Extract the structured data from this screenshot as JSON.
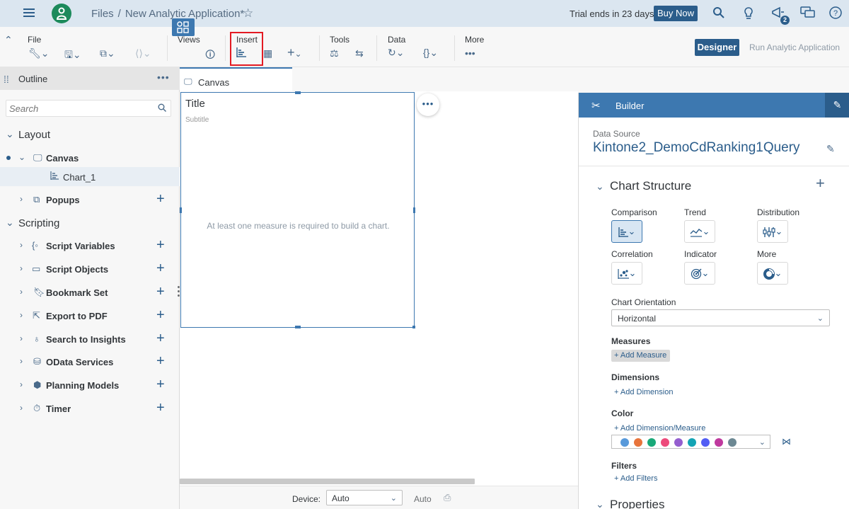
{
  "shell": {
    "breadcrumb_root": "Files",
    "breadcrumb_sep": "/",
    "breadcrumb_current": "New Analytic Application*",
    "trial_text": "Trial ends in 23 days",
    "buy_label": "Buy Now",
    "notification_count": "2"
  },
  "toolbar": {
    "file_label": "File",
    "views_label": "Views",
    "insert_label": "Insert",
    "tools_label": "Tools",
    "data_label": "Data",
    "more_label": "More",
    "designer_label": "Designer",
    "run_label": "Run Analytic Application"
  },
  "outline": {
    "title": "Outline",
    "search_placeholder": "Search",
    "layout_label": "Layout",
    "scripting_label": "Scripting",
    "canvas_label": "Canvas",
    "chart_label": "Chart_1",
    "popups_label": "Popups",
    "scripting_items": [
      {
        "label": "Script Variables",
        "icon": "script-variable-icon"
      },
      {
        "label": "Script Objects",
        "icon": "script-object-icon"
      },
      {
        "label": "Bookmark Set",
        "icon": "bookmark-icon"
      },
      {
        "label": "Export to PDF",
        "icon": "export-icon"
      },
      {
        "label": "Search to Insights",
        "icon": "lightbulb-icon"
      },
      {
        "label": "OData Services",
        "icon": "database-icon"
      },
      {
        "label": "Planning Models",
        "icon": "cube-icon"
      },
      {
        "label": "Timer",
        "icon": "timer-icon"
      }
    ]
  },
  "canvas": {
    "tab_label": "Canvas",
    "chart_title": "Title",
    "chart_subtitle": "Subtitle",
    "chart_message": "At least one measure is required to build a chart.",
    "device_label": "Device:",
    "device_value": "Auto",
    "auto_label": "Auto"
  },
  "builder": {
    "title": "Builder",
    "data_source_label": "Data Source",
    "data_source_name": "Kintone2_DemoCdRanking1Query",
    "chart_structure_label": "Chart Structure",
    "chart_types": [
      {
        "label": "Comparison",
        "icon": "bar-chart-icon",
        "active": true
      },
      {
        "label": "Trend",
        "icon": "line-chart-icon",
        "active": false
      },
      {
        "label": "Distribution",
        "icon": "box-plot-icon",
        "active": false
      },
      {
        "label": "Correlation",
        "icon": "scatter-icon",
        "active": false
      },
      {
        "label": "Indicator",
        "icon": "target-icon",
        "active": false
      },
      {
        "label": "More",
        "icon": "donut-icon",
        "active": false
      }
    ],
    "orientation_label": "Chart Orientation",
    "orientation_value": "Horizontal",
    "measures_label": "Measures",
    "add_measure_label": "+ Add Measure",
    "dimensions_label": "Dimensions",
    "add_dimension_label": "+ Add Dimension",
    "color_label": "Color",
    "add_color_label": "+ Add Dimension/Measure",
    "palette": [
      "#5899da",
      "#e8743b",
      "#19a979",
      "#ed4a7b",
      "#945ecf",
      "#13a4b4",
      "#525df4",
      "#bf399e",
      "#6c8893"
    ],
    "filters_label": "Filters",
    "add_filters_label": "+ Add Filters",
    "properties_label": "Properties"
  }
}
